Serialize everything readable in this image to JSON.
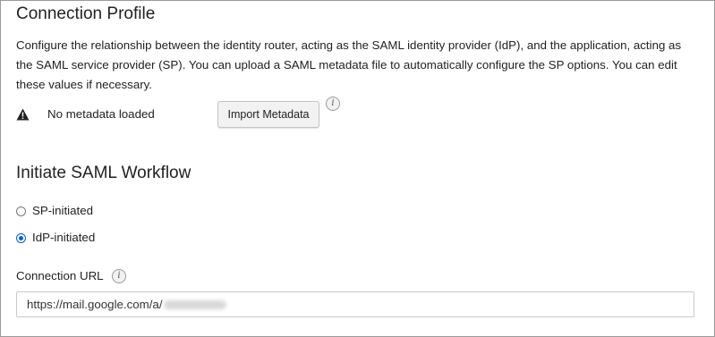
{
  "connection_profile": {
    "title": "Connection Profile",
    "description": "Configure the relationship between the identity router, acting as the SAML identity provider (IdP), and the application, acting as the SAML service provider (SP). You can upload a SAML metadata file to automatically configure the SP options. You can edit these values if necessary.",
    "metadata_status": "No metadata loaded",
    "import_button_label": "Import Metadata",
    "info_glyph": "i",
    "icons": [
      "warning-icon",
      "info-icon"
    ]
  },
  "workflow": {
    "title": "Initiate SAML Workflow",
    "options": [
      {
        "label": "SP-initiated",
        "selected": false
      },
      {
        "label": "IdP-initiated",
        "selected": true
      }
    ],
    "accent_color": "#0060df"
  },
  "connection_url": {
    "label": "Connection URL",
    "info_glyph": "i",
    "value_visible": "https://mail.google.com/a/"
  }
}
